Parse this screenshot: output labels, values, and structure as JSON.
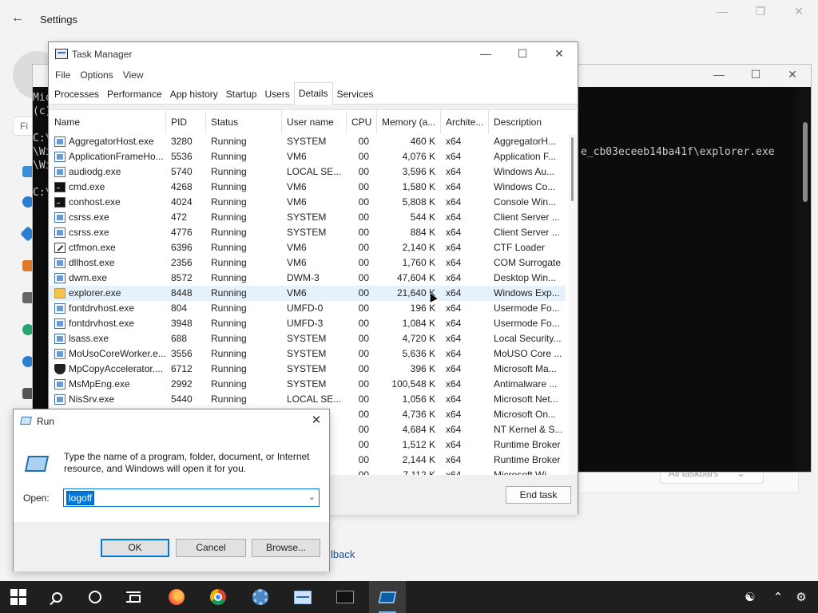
{
  "settings": {
    "title": "Settings",
    "find_placeholder": "Fi",
    "dropdown_value": "All taskbars",
    "link_fragment": "lback"
  },
  "console": {
    "lines": [
      "Mic",
      "(c)",
      "C:\\",
      "\\Wi",
      "\\Wi",
      "C:\\"
    ],
    "path_fragment": "e_cb03eceeb14ba41f\\explorer.exe"
  },
  "taskmgr": {
    "title": "Task Manager",
    "menu": [
      "File",
      "Options",
      "View"
    ],
    "tabs": [
      "Processes",
      "Performance",
      "App history",
      "Startup",
      "Users",
      "Details",
      "Services"
    ],
    "active_tab": "Details",
    "columns": [
      "Name",
      "PID",
      "Status",
      "User name",
      "CPU",
      "Memory (a...",
      "Archite...",
      "Description"
    ],
    "rows": [
      {
        "icon": "window-icon",
        "name": "AggregatorHost.exe",
        "pid": "3280",
        "status": "Running",
        "user": "SYSTEM",
        "cpu": "00",
        "mem": "460 K",
        "arch": "x64",
        "desc": "AggregatorH..."
      },
      {
        "icon": "window-icon",
        "name": "ApplicationFrameHo...",
        "pid": "5536",
        "status": "Running",
        "user": "VM6",
        "cpu": "00",
        "mem": "4,076 K",
        "arch": "x64",
        "desc": "Application F..."
      },
      {
        "icon": "window-icon",
        "name": "audiodg.exe",
        "pid": "5740",
        "status": "Running",
        "user": "LOCAL SE...",
        "cpu": "00",
        "mem": "3,596 K",
        "arch": "x64",
        "desc": "Windows Au..."
      },
      {
        "icon": "cmd-icon",
        "name": "cmd.exe",
        "pid": "4268",
        "status": "Running",
        "user": "VM6",
        "cpu": "00",
        "mem": "1,580 K",
        "arch": "x64",
        "desc": "Windows Co..."
      },
      {
        "icon": "cmd-icon",
        "name": "conhost.exe",
        "pid": "4024",
        "status": "Running",
        "user": "VM6",
        "cpu": "00",
        "mem": "5,808 K",
        "arch": "x64",
        "desc": "Console Win..."
      },
      {
        "icon": "window-icon",
        "name": "csrss.exe",
        "pid": "472",
        "status": "Running",
        "user": "SYSTEM",
        "cpu": "00",
        "mem": "544 K",
        "arch": "x64",
        "desc": "Client Server ..."
      },
      {
        "icon": "window-icon",
        "name": "csrss.exe",
        "pid": "4776",
        "status": "Running",
        "user": "SYSTEM",
        "cpu": "00",
        "mem": "884 K",
        "arch": "x64",
        "desc": "Client Server ..."
      },
      {
        "icon": "pen-icon",
        "name": "ctfmon.exe",
        "pid": "6396",
        "status": "Running",
        "user": "VM6",
        "cpu": "00",
        "mem": "2,140 K",
        "arch": "x64",
        "desc": "CTF Loader"
      },
      {
        "icon": "window-icon",
        "name": "dllhost.exe",
        "pid": "2356",
        "status": "Running",
        "user": "VM6",
        "cpu": "00",
        "mem": "1,760 K",
        "arch": "x64",
        "desc": "COM Surrogate"
      },
      {
        "icon": "window-icon",
        "name": "dwm.exe",
        "pid": "8572",
        "status": "Running",
        "user": "DWM-3",
        "cpu": "00",
        "mem": "47,604 K",
        "arch": "x64",
        "desc": "Desktop Win..."
      },
      {
        "icon": "folder-icon",
        "name": "explorer.exe",
        "pid": "8448",
        "status": "Running",
        "user": "VM6",
        "cpu": "00",
        "mem": "21,640 K",
        "arch": "x64",
        "desc": "Windows Exp..."
      },
      {
        "icon": "window-icon",
        "name": "fontdrvhost.exe",
        "pid": "804",
        "status": "Running",
        "user": "UMFD-0",
        "cpu": "00",
        "mem": "196 K",
        "arch": "x64",
        "desc": "Usermode Fo..."
      },
      {
        "icon": "window-icon",
        "name": "fontdrvhost.exe",
        "pid": "3948",
        "status": "Running",
        "user": "UMFD-3",
        "cpu": "00",
        "mem": "1,084 K",
        "arch": "x64",
        "desc": "Usermode Fo..."
      },
      {
        "icon": "window-icon",
        "name": "lsass.exe",
        "pid": "688",
        "status": "Running",
        "user": "SYSTEM",
        "cpu": "00",
        "mem": "4,720 K",
        "arch": "x64",
        "desc": "Local Security..."
      },
      {
        "icon": "window-icon",
        "name": "MoUsoCoreWorker.e...",
        "pid": "3556",
        "status": "Running",
        "user": "SYSTEM",
        "cpu": "00",
        "mem": "5,636 K",
        "arch": "x64",
        "desc": "MoUSO Core ..."
      },
      {
        "icon": "shield-icon",
        "name": "MpCopyAccelerator....",
        "pid": "6712",
        "status": "Running",
        "user": "SYSTEM",
        "cpu": "00",
        "mem": "396 K",
        "arch": "x64",
        "desc": "Microsoft Ma..."
      },
      {
        "icon": "window-icon",
        "name": "MsMpEng.exe",
        "pid": "2992",
        "status": "Running",
        "user": "SYSTEM",
        "cpu": "00",
        "mem": "100,548 K",
        "arch": "x64",
        "desc": "Antimalware ..."
      },
      {
        "icon": "window-icon",
        "name": "NisSrv.exe",
        "pid": "5440",
        "status": "Running",
        "user": "LOCAL SE...",
        "cpu": "00",
        "mem": "1,056 K",
        "arch": "x64",
        "desc": "Microsoft Net..."
      },
      {
        "icon": "window-icon",
        "name": "",
        "pid": "",
        "status": "",
        "user": "",
        "cpu": "00",
        "mem": "4,736 K",
        "arch": "x64",
        "desc": "Microsoft On..."
      },
      {
        "icon": "window-icon",
        "name": "",
        "pid": "",
        "status": "",
        "user": "",
        "cpu": "00",
        "mem": "4,684 K",
        "arch": "x64",
        "desc": "NT Kernel & S..."
      },
      {
        "icon": "window-icon",
        "name": "",
        "pid": "",
        "status": "",
        "user": "",
        "cpu": "00",
        "mem": "1,512 K",
        "arch": "x64",
        "desc": "Runtime Broker"
      },
      {
        "icon": "window-icon",
        "name": "",
        "pid": "",
        "status": "",
        "user": "",
        "cpu": "00",
        "mem": "2,144 K",
        "arch": "x64",
        "desc": "Runtime Broker"
      },
      {
        "icon": "window-icon",
        "name": "",
        "pid": "",
        "status": "",
        "user": "",
        "cpu": "00",
        "mem": "7,112 K",
        "arch": "x64",
        "desc": "Microsoft Wi..."
      }
    ],
    "selected_row": 10,
    "end_task_label": "End task"
  },
  "run": {
    "title": "Run",
    "description": "Type the name of a program, folder, document, or Internet resource, and Windows will open it for you.",
    "open_label": "Open:",
    "open_value": "logoff",
    "ok_label": "OK",
    "cancel_label": "Cancel",
    "browse_label": "Browse..."
  },
  "taskbar": {
    "items": [
      "start-icon",
      "search-icon",
      "cortana-icon",
      "task-view-icon",
      "firefox-icon",
      "chrome-icon",
      "settings-gear-icon",
      "task-manager-icon",
      "command-prompt-icon",
      "run-icon"
    ],
    "active": "run-icon",
    "tray": [
      "people-icon",
      "chevron-up-icon",
      "gear-icon"
    ]
  },
  "colors": {
    "accent": "#0078d7",
    "selection": "#e5f1fb",
    "taskbar": "#1f1f1f",
    "console_bg": "#0c0c0c"
  }
}
